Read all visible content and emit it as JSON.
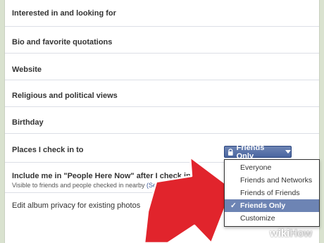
{
  "settings": {
    "rows": [
      {
        "label": "Interested in and looking for"
      },
      {
        "label": "Bio and favorite quotations"
      },
      {
        "label": "Website"
      },
      {
        "label": "Religious and political views"
      },
      {
        "label": "Birthday"
      },
      {
        "label": "Places I check in to"
      },
      {
        "label": "Include me in \"People Here Now\" after I check in",
        "sub": "Visible to friends and people checked in nearby",
        "sub_link": "(See"
      },
      {
        "label": "Edit album privacy for existing photos"
      }
    ]
  },
  "privacy_button": {
    "label": "Friends Only"
  },
  "dropdown": {
    "options": [
      "Everyone",
      "Friends and Networks",
      "Friends of Friends",
      "Friends Only",
      "Customize"
    ],
    "selected": "Friends Only"
  },
  "colors": {
    "accent": "#3b5998",
    "button": "#5b74a8",
    "selected_bg": "#6d84b4",
    "arrow": "#e1242c"
  },
  "watermark": {
    "wiki": "wiki",
    "how": "How"
  }
}
